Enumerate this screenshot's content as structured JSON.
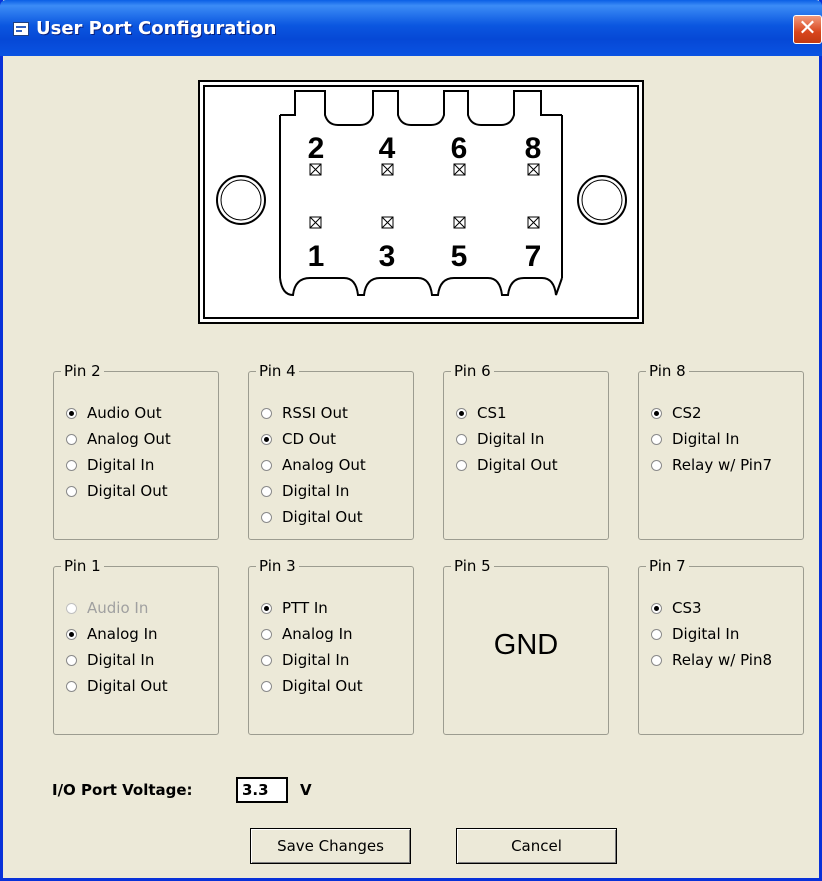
{
  "window": {
    "title": "User Port Configuration",
    "close_glyph": "✕"
  },
  "connector": {
    "top_pins": [
      "2",
      "4",
      "6",
      "8"
    ],
    "bottom_pins": [
      "1",
      "3",
      "5",
      "7"
    ]
  },
  "groups": {
    "pin2": {
      "label": "Pin 2",
      "options": [
        {
          "label": "Audio Out",
          "selected": true
        },
        {
          "label": "Analog Out",
          "selected": false
        },
        {
          "label": "Digital In",
          "selected": false
        },
        {
          "label": "Digital Out",
          "selected": false
        }
      ]
    },
    "pin4": {
      "label": "Pin 4",
      "options": [
        {
          "label": "RSSI Out",
          "selected": false
        },
        {
          "label": "CD Out",
          "selected": true
        },
        {
          "label": "Analog Out",
          "selected": false
        },
        {
          "label": "Digital In",
          "selected": false
        },
        {
          "label": "Digital Out",
          "selected": false
        }
      ]
    },
    "pin6": {
      "label": "Pin 6",
      "options": [
        {
          "label": "CS1",
          "selected": true
        },
        {
          "label": "Digital In",
          "selected": false
        },
        {
          "label": "Digital Out",
          "selected": false
        }
      ]
    },
    "pin8": {
      "label": "Pin 8",
      "options": [
        {
          "label": "CS2",
          "selected": true
        },
        {
          "label": "Digital In",
          "selected": false
        },
        {
          "label": "Relay w/ Pin7",
          "selected": false
        }
      ]
    },
    "pin1": {
      "label": "Pin 1",
      "options": [
        {
          "label": "Audio In",
          "selected": false,
          "disabled": true
        },
        {
          "label": "Analog In",
          "selected": true
        },
        {
          "label": "Digital In",
          "selected": false
        },
        {
          "label": "Digital Out",
          "selected": false
        }
      ]
    },
    "pin3": {
      "label": "Pin 3",
      "options": [
        {
          "label": "PTT In",
          "selected": true
        },
        {
          "label": "Analog In",
          "selected": false
        },
        {
          "label": "Digital In",
          "selected": false
        },
        {
          "label": "Digital Out",
          "selected": false
        }
      ]
    },
    "pin5": {
      "label": "Pin 5",
      "text": "GND"
    },
    "pin7": {
      "label": "Pin 7",
      "options": [
        {
          "label": "CS3",
          "selected": true
        },
        {
          "label": "Digital In",
          "selected": false
        },
        {
          "label": "Relay w/ Pin8",
          "selected": false
        }
      ]
    }
  },
  "voltage": {
    "label": "I/O Port Voltage:",
    "value": "3.3",
    "unit": "V"
  },
  "buttons": {
    "save": "Save Changes",
    "cancel": "Cancel"
  }
}
